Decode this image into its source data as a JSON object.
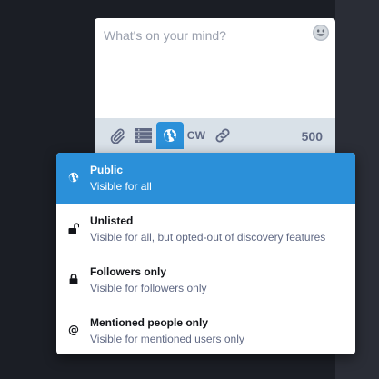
{
  "compose": {
    "placeholder": "What's on your mind?",
    "char_count": "500",
    "cw_label": "CW"
  },
  "icons": {
    "emoji": "emoji-smile-icon",
    "attach": "paperclip-icon",
    "poll": "poll-list-icon",
    "privacy": "globe-icon",
    "link": "link-icon"
  },
  "visibility_menu": {
    "options": [
      {
        "title": "Public",
        "description": "Visible for all",
        "icon": "globe-icon",
        "selected": true
      },
      {
        "title": "Unlisted",
        "description": "Visible for all, but opted-out of discovery features",
        "icon": "unlock-icon",
        "selected": false
      },
      {
        "title": "Followers only",
        "description": "Visible for followers only",
        "icon": "lock-icon",
        "selected": false
      },
      {
        "title": "Mentioned people only",
        "description": "Visible for mentioned users only",
        "icon": "at-sign-icon",
        "selected": false
      }
    ]
  },
  "colors": {
    "accent": "#2b90d9",
    "toolbar_bg": "#d9e1e8",
    "text_dark": "#121419",
    "text_muted": "#606984",
    "background": "#1b1e25"
  }
}
